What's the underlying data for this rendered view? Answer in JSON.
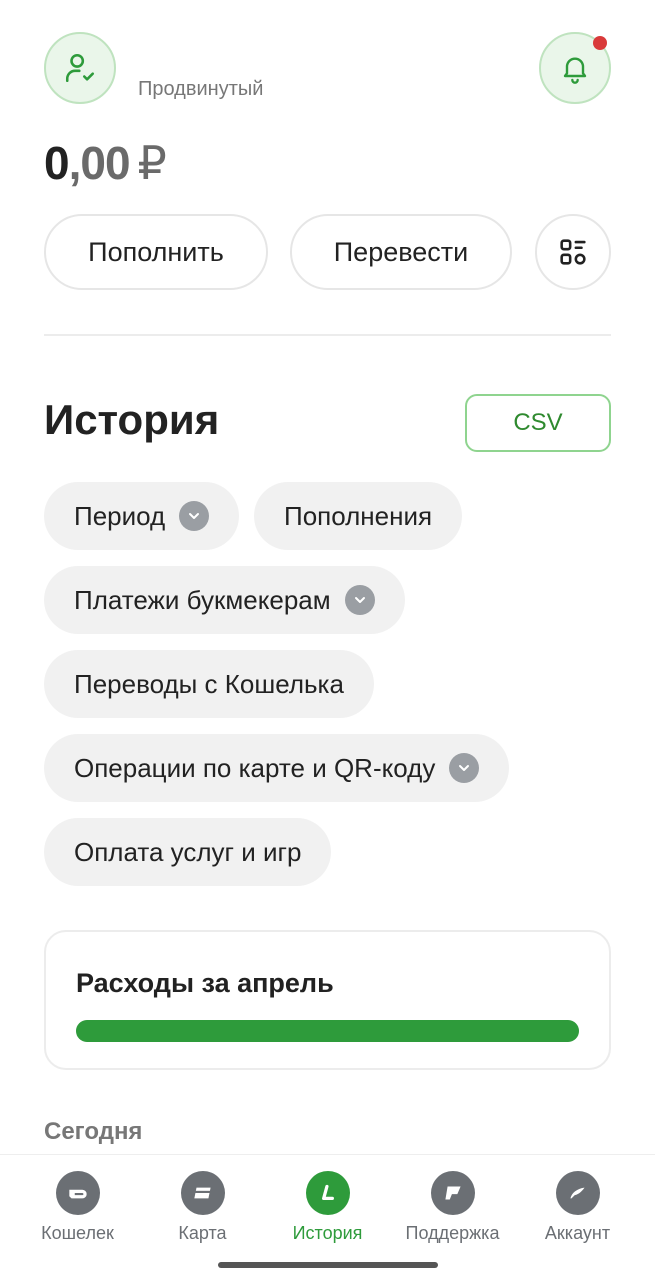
{
  "header": {
    "status_label": "Продвинутый"
  },
  "balance": {
    "integer": "0",
    "decimals": ",00",
    "currency": "₽"
  },
  "actions": {
    "topup_label": "Пополнить",
    "transfer_label": "Перевести"
  },
  "history": {
    "title": "История",
    "csv_label": "CSV",
    "filters": [
      {
        "label": "Период",
        "has_dropdown": true
      },
      {
        "label": "Пополнения",
        "has_dropdown": false
      },
      {
        "label": "Платежи букмекерам",
        "has_dropdown": true
      },
      {
        "label": "Переводы с Кошелька",
        "has_dropdown": false
      },
      {
        "label": "Операции по карте и QR-коду",
        "has_dropdown": true
      },
      {
        "label": "Оплата услуг и игр",
        "has_dropdown": false
      }
    ]
  },
  "expenses": {
    "title": "Расходы за апрель",
    "fill_fraction": 1.0,
    "bar_color": "#2e9b3b"
  },
  "feed": {
    "today_label": "Сегодня"
  },
  "tabbar": {
    "items": [
      {
        "label": "Кошелек",
        "icon": "wallet-icon"
      },
      {
        "label": "Карта",
        "icon": "card-icon"
      },
      {
        "label": "История",
        "icon": "history-icon",
        "active": true
      },
      {
        "label": "Поддержка",
        "icon": "support-icon"
      },
      {
        "label": "Аккаунт",
        "icon": "account-icon"
      }
    ]
  },
  "colors": {
    "accent": "#2e9b3b",
    "notification_dot": "#d93a3a"
  }
}
